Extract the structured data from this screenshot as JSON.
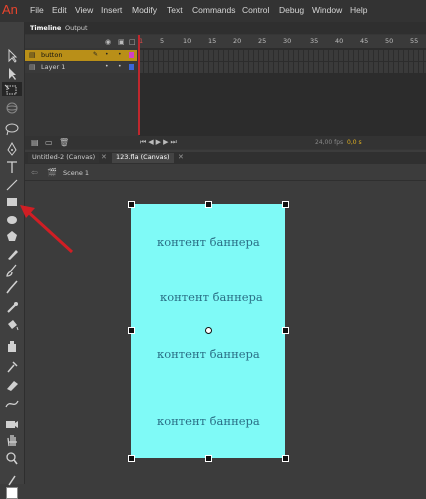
{
  "app": {
    "logo": "An"
  },
  "menu": [
    "File",
    "Edit",
    "View",
    "Insert",
    "Modify",
    "Text",
    "Commands",
    "Control",
    "Debug",
    "Window",
    "Help"
  ],
  "timeline": {
    "tabs": [
      "Timeline",
      "Output"
    ],
    "frame_numbers": [
      "1",
      "5",
      "10",
      "15",
      "20",
      "25",
      "30",
      "35",
      "40",
      "45",
      "50",
      "55"
    ],
    "layers": [
      {
        "name": "button"
      },
      {
        "name": "Layer 1"
      }
    ],
    "fps": "24,00 fps",
    "time": "0,0 s"
  },
  "documents": {
    "tabs": [
      "Untitled-2 (Canvas)",
      "123.fla (Canvas)"
    ]
  },
  "editbar": {
    "scene": "Scene 1"
  },
  "stage": {
    "banner_color": "#7ffaf7",
    "banner_texts": [
      "контент баннера",
      "контент баннера",
      "контент баннера",
      "контент баннера"
    ]
  },
  "colors": {
    "accent": "#e8442d",
    "layer_highlight": "#b98f18",
    "arrow": "#d01e24"
  }
}
